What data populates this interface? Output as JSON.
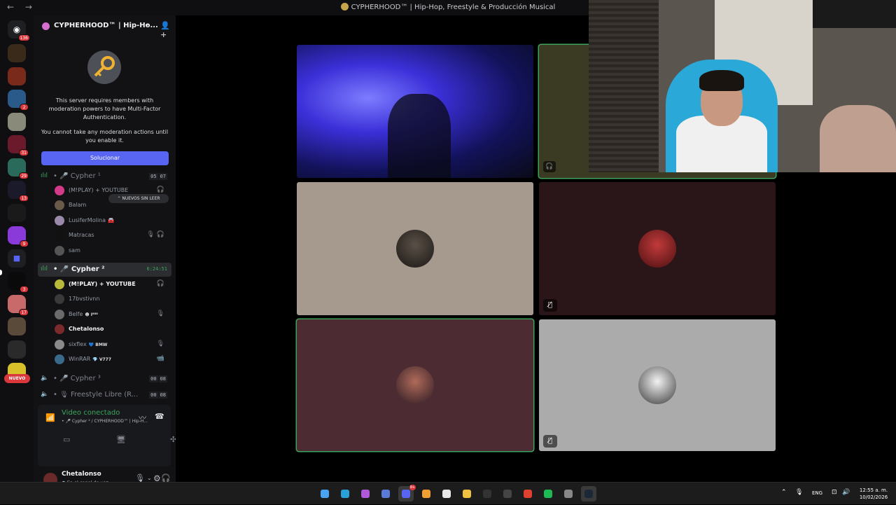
{
  "window": {
    "title": "CYPHERHOOD™ | Hip-Hop, Freestyle & Producción Musical",
    "nav": "← →"
  },
  "rail": {
    "home_badge": "136",
    "servers": [
      {
        "name": "server-ch",
        "badge": ""
      },
      {
        "name": "server-2",
        "badge": ""
      },
      {
        "name": "server-3",
        "badge": "2"
      },
      {
        "name": "server-4",
        "badge": ""
      },
      {
        "name": "server-5",
        "badge": "31"
      },
      {
        "name": "server-6",
        "badge": "29"
      },
      {
        "name": "server-7",
        "badge": "13"
      },
      {
        "name": "server-8",
        "badge": ""
      },
      {
        "name": "server-9",
        "badge": "9"
      },
      {
        "name": "folder",
        "badge": ""
      },
      {
        "name": "server-11",
        "badge": "3"
      },
      {
        "name": "server-12",
        "badge": "17"
      },
      {
        "name": "server-13",
        "badge": ""
      },
      {
        "name": "server-14",
        "badge": ""
      },
      {
        "name": "server-15",
        "badge": ""
      }
    ],
    "nuevo": "NUEVO"
  },
  "server": {
    "name": "CYPHERHOOD™ | Hip-Ho..."
  },
  "mfa": {
    "line1": "This server requires members with moderation powers to have Multi-Factor Authentication.",
    "line2": "You cannot take any moderation actions until you enable it.",
    "button": "Solucionar"
  },
  "unread": "⌃ NUEVOS SIN LEER",
  "channels": {
    "cypher1": {
      "name": "Cypher ¹",
      "c1": "05",
      "c2": "07"
    },
    "cypher1_members": [
      {
        "name": "(M!PLAY) + YOUTUBE",
        "right": "🎧"
      },
      {
        "name": "Balam",
        "right": ""
      },
      {
        "name": "LusiferMolina 🚘",
        "right": ""
      },
      {
        "name": "Matracas",
        "right": "🎙 🎧"
      },
      {
        "name": "sam",
        "right": ""
      }
    ],
    "cypher2": {
      "name": "Cypher ²",
      "time": "6:24:51"
    },
    "cypher2_members": [
      {
        "name": "(M!PLAY) + YOUTUBE",
        "right": "🎧"
      },
      {
        "name": "17bvstivnn",
        "right": ""
      },
      {
        "name": "Belfe",
        "tag": "☻ I⁸⁸⁸",
        "right": "🎙"
      },
      {
        "name": "Chetalonso",
        "right": ""
      },
      {
        "name": "sixflex",
        "tag": "💙 BMW",
        "right": "🎙"
      },
      {
        "name": "WinRAR",
        "tag": "💎 V777",
        "right": "📹"
      }
    ],
    "cypher3": {
      "name": "Cypher ³",
      "c1": "00",
      "c2": "08"
    },
    "freestyle": {
      "name": "Freestyle Libre (R...",
      "c1": "00",
      "c2": "08"
    }
  },
  "voice": {
    "status": "Video conectado",
    "sub": "• 🎤 Cypher ² / CYPHERHOOD™ | Hip-H..."
  },
  "user": {
    "name": "Chetalonso",
    "status": "● En el canal de voz"
  },
  "taskbar": {
    "lang": "ENG",
    "time": "12:55 a. m.",
    "date": "10/02/2026",
    "discord_badge": "9+"
  }
}
